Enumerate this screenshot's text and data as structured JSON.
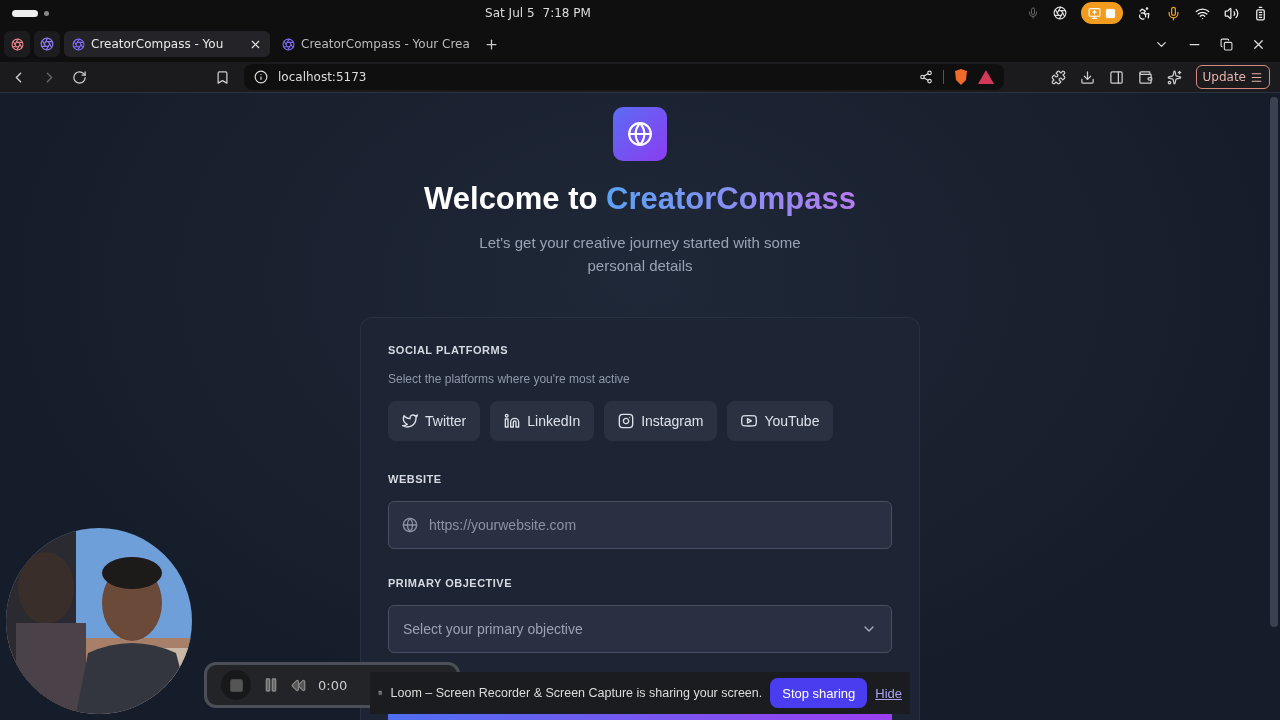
{
  "system_bar": {
    "date": "Sat Jul 5",
    "time": "7:18 PM"
  },
  "browser": {
    "tabs": [
      {
        "title": "CreatorCompass - You",
        "selected": true
      },
      {
        "title": "CreatorCompass - Your Crea",
        "selected": false
      }
    ],
    "address": "localhost:5173",
    "update_button": "Update"
  },
  "page": {
    "title_prefix": "Welcome to ",
    "title_brand": "CreatorCompass",
    "subtitle": "Let's get your creative journey started with some personal details",
    "social": {
      "heading": "SOCIAL PLATFORMS",
      "hint": "Select the platforms where you're most active",
      "platforms": [
        {
          "label": "Twitter",
          "kind": "twitter",
          "selected": false
        },
        {
          "label": "LinkedIn",
          "kind": "linkedin",
          "selected": false
        },
        {
          "label": "Instagram",
          "kind": "instagram",
          "selected": false
        },
        {
          "label": "YouTube",
          "kind": "youtube",
          "selected": false
        }
      ]
    },
    "website": {
      "label": "WEBSITE",
      "placeholder": "https://yourwebsite.com"
    },
    "objective": {
      "label": "PRIMARY OBJECTIVE",
      "placeholder": "Select your primary objective"
    }
  },
  "recorder": {
    "time": "0:00"
  },
  "share_bar": {
    "message": "Loom – Screen Recorder & Screen Capture is sharing your screen.",
    "stop": "Stop sharing",
    "hide": "Hide"
  }
}
